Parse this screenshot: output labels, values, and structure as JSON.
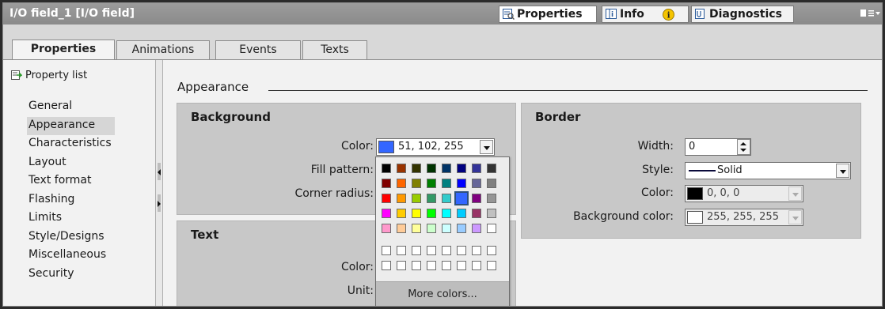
{
  "window": {
    "title": "I/O field_1 [I/O field]"
  },
  "inspector_tabs": [
    {
      "label": "Properties",
      "icon": "properties-icon",
      "active": true
    },
    {
      "label": "Info",
      "icon": "info-icon",
      "active": false
    },
    {
      "label": "Diagnostics",
      "icon": "diagnostics-icon",
      "active": false
    }
  ],
  "sub_tabs": [
    {
      "label": "Properties",
      "active": true
    },
    {
      "label": "Animations",
      "active": false
    },
    {
      "label": "Events",
      "active": false
    },
    {
      "label": "Texts",
      "active": false
    }
  ],
  "sidebar": {
    "header": "Property list",
    "items": [
      "General",
      "Appearance",
      "Characteristics",
      "Layout",
      "Text format",
      "Flashing",
      "Limits",
      "Style/Designs",
      "Miscellaneous",
      "Security"
    ],
    "selected": "Appearance"
  },
  "main": {
    "section_title": "Appearance",
    "background": {
      "title": "Background",
      "color_label": "Color:",
      "color_value": "51, 102, 255",
      "color_hex": "#3366ff",
      "fill_pattern_label": "Fill pattern:",
      "corner_radius_label": "Corner radius:"
    },
    "text": {
      "title": "Text",
      "color_label": "Color:",
      "unit_label": "Unit:"
    },
    "border": {
      "title": "Border",
      "width_label": "Width:",
      "width_value": "0",
      "style_label": "Style:",
      "style_value": "Solid",
      "color_label": "Color:",
      "color_value": "0, 0, 0",
      "color_hex": "#000000",
      "bg_color_label": "Background color:",
      "bg_color_value": "255, 255, 255",
      "bg_color_hex": "#ffffff"
    }
  },
  "color_popup": {
    "palette": [
      [
        "#000000",
        "#993300",
        "#333300",
        "#003300",
        "#003366",
        "#000080",
        "#333399",
        "#333333"
      ],
      [
        "#800000",
        "#ff6600",
        "#808000",
        "#008000",
        "#008080",
        "#0000ff",
        "#666699",
        "#808080"
      ],
      [
        "#ff0000",
        "#ff9900",
        "#99cc00",
        "#339966",
        "#33cccc",
        "#3366ff",
        "#800080",
        "#969696"
      ],
      [
        "#ff00ff",
        "#ffcc00",
        "#ffff00",
        "#00ff00",
        "#00ffff",
        "#00ccff",
        "#993366",
        "#c0c0c0"
      ],
      [
        "#ff99cc",
        "#ffcc99",
        "#ffff99",
        "#ccffcc",
        "#ccffff",
        "#99ccff",
        "#cc99ff",
        "#ffffff"
      ]
    ],
    "custom_rows": [
      [
        "#ffffff",
        "#ffffff",
        "#ffffff",
        "#ffffff",
        "#ffffff",
        "#ffffff",
        "#ffffff",
        "#ffffff"
      ],
      [
        "#ffffff",
        "#ffffff",
        "#ffffff",
        "#ffffff",
        "#ffffff",
        "#ffffff",
        "#ffffff",
        "#ffffff"
      ]
    ],
    "selected_color": "#3366ff",
    "more_colors_label": "More colors..."
  }
}
